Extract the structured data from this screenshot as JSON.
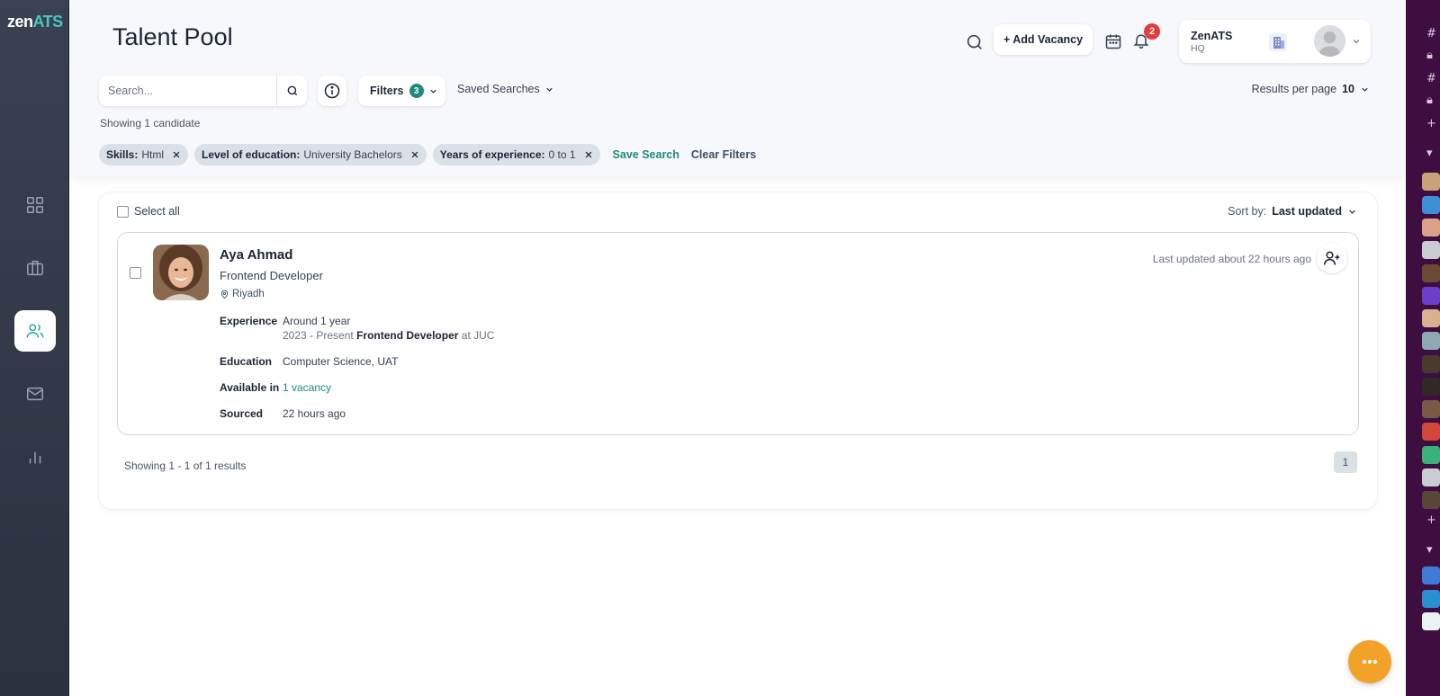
{
  "app": {
    "logo_main": "zen",
    "logo_accent": "ATS"
  },
  "page": {
    "title": "Talent Pool"
  },
  "header": {
    "add_vacancy_label": "+ Add Vacancy",
    "notification_count": "2",
    "account": {
      "name": "ZenATS",
      "sub": "HQ"
    }
  },
  "sidebar": {
    "items": [
      {
        "name": "dashboard",
        "icon": "grid-icon"
      },
      {
        "name": "vacancies",
        "icon": "briefcase-icon"
      },
      {
        "name": "talent-pool",
        "icon": "users-icon",
        "active": true
      },
      {
        "name": "messages",
        "icon": "mail-icon"
      },
      {
        "name": "reports",
        "icon": "bar-chart-icon"
      }
    ]
  },
  "toolbar": {
    "search_placeholder": "Search...",
    "filters_label": "Filters",
    "filters_count": "3",
    "saved_searches_label": "Saved Searches",
    "results_per_page_label": "Results per page",
    "results_per_page_value": "10"
  },
  "summary": {
    "showing": "Showing 1 candidate"
  },
  "filters": {
    "chips": [
      {
        "key": "Skills:",
        "value": "Html"
      },
      {
        "key": "Level of education:",
        "value": "University Bachelors"
      },
      {
        "key": "Years of experience:",
        "value": "0 to 1"
      }
    ],
    "save_search_label": "Save Search",
    "clear_filters_label": "Clear Filters"
  },
  "list": {
    "select_all_label": "Select all",
    "sort_label": "Sort by:",
    "sort_value": "Last updated",
    "candidates": [
      {
        "name": "Aya Ahmad",
        "role": "Frontend Developer",
        "location": "Riyadh",
        "last_updated": "Last updated about 22 hours ago",
        "experience_label": "Experience",
        "experience_value": "Around 1 year",
        "experience_period": "2023 - Present",
        "experience_title": "Frontend Developer",
        "experience_at": "at JUC",
        "education_label": "Education",
        "education_value": "Computer Science, UAT",
        "available_label": "Available in",
        "available_value": "1 vacancy",
        "sourced_label": "Sourced",
        "sourced_value": "22 hours ago"
      }
    ],
    "pager_text": "Showing 1 - 1 of 1 results",
    "current_page": "1"
  },
  "colors": {
    "accent": "#1f8a7a",
    "brand": "#49c6c3",
    "fab": "#f2a228",
    "badge": "#e23b3b"
  }
}
